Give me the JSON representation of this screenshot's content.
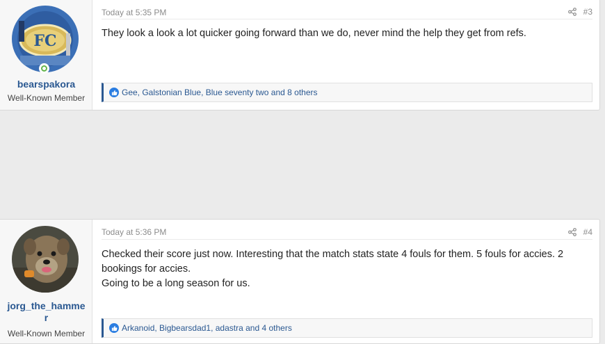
{
  "posts": [
    {
      "username": "bearspakora",
      "user_title": "Well-Known Member",
      "date": "Today at 5:35 PM",
      "post_number": "#3",
      "message_lines": [
        "They look a look a lot quicker going forward than we do, never mind the help they get from refs."
      ],
      "reactions": "Gee, Galstonian Blue, Blue seventy two and 8 others",
      "online": true
    },
    {
      "username_line1": "jorg_the_hamme",
      "username_line2": "r",
      "user_title": "Well-Known Member",
      "date": "Today at 5:36 PM",
      "post_number": "#4",
      "message_lines": [
        "Checked their score just now. Interesting that the match stats state 4 fouls for them. 5 fouls for accies. 2",
        "bookings for accies.",
        "Going to be a long season for us."
      ],
      "reactions": "Arkanoid, Bigbearsdad1, adastra and 4 others"
    }
  ],
  "icons": {
    "share": "share-icon",
    "like": "like-icon",
    "online": "online-status-icon"
  },
  "colors": {
    "accent": "#2a5891",
    "online": "#63b44a",
    "like": "#2a7de1"
  },
  "avatar_lettering": "FC"
}
